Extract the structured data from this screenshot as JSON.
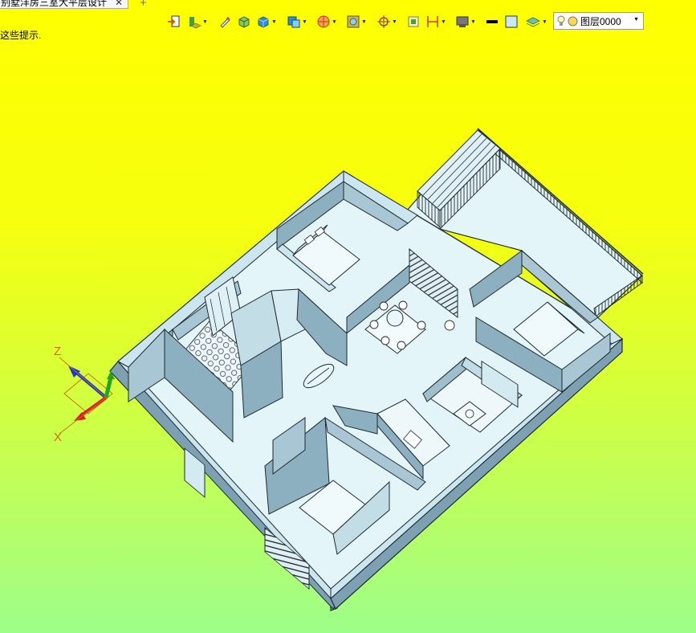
{
  "tab": {
    "title": "别墅洋房三室大平层设计",
    "close_glyph": "✕",
    "new_glyph": "+"
  },
  "hint_text": "这些提示.",
  "toolbar": {
    "layer_name": "图层0000",
    "buttons": [
      {
        "name": "exit-sketch-icon"
      },
      {
        "name": "layer-tool-icon"
      },
      {
        "name": "pen-tool-icon"
      },
      {
        "name": "solid-box-icon"
      },
      {
        "name": "box-view-icon"
      },
      {
        "name": "render-mode-icon"
      },
      {
        "name": "snap-target-icon"
      },
      {
        "name": "select-filter-icon"
      },
      {
        "name": "coordinate-icon"
      },
      {
        "name": "frame-icon"
      },
      {
        "name": "dimension-icon"
      },
      {
        "name": "display-mode-icon"
      },
      {
        "name": "line-color-icon"
      },
      {
        "name": "fill-color-icon"
      },
      {
        "name": "layers-stack-icon"
      }
    ]
  },
  "axes": {
    "z_label": "Z",
    "x_label": "X"
  },
  "colors": {
    "wall": "#7da0b2",
    "wall_top": "#cbe6ef",
    "floor": "#e4f5f9",
    "outline": "#1d2a30",
    "bg_top": "#ffff00",
    "bg_bottom": "#9dfe8a"
  }
}
